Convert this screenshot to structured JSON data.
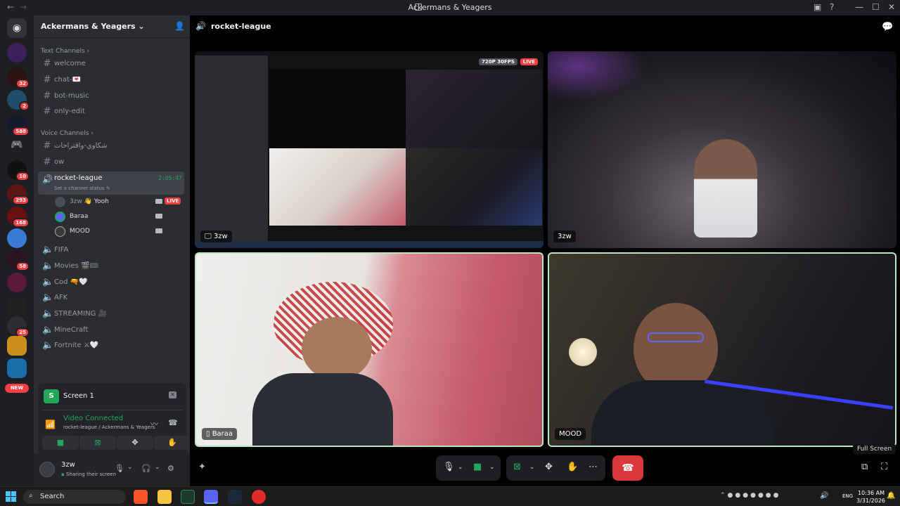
{
  "window": {
    "title": "Ackermans & Yeagers",
    "controls": [
      "minimize",
      "maximize",
      "close"
    ]
  },
  "servers": {
    "badges": [
      "32",
      "2",
      "588",
      "10",
      "293",
      "168",
      "58",
      "25"
    ],
    "new_label": "NEW"
  },
  "server": {
    "name": "Ackermans & Yeagers",
    "text_category": "Text Channels",
    "text_channels": [
      "welcome",
      "chat-💌",
      "bot-music",
      "only-edit"
    ],
    "voice_category": "Voice Channels",
    "voice_channels_top": [
      "شكاوي-واقتراحات",
      "ow"
    ],
    "active_channel": {
      "name": "rocket-league",
      "time": "2:05:47",
      "status_placeholder": "Set a channel status"
    },
    "voice_users": [
      {
        "name": "3zw",
        "suffix": "👋 Yooh",
        "live": "LIVE"
      },
      {
        "name": "Baraa"
      },
      {
        "name": "MOOD"
      }
    ],
    "voice_channels_bottom": [
      "FIFA",
      "Movies 🎬🎟",
      "Cod 🔫🤍",
      "AFK",
      "STREAMING 🎥",
      "MineCraft",
      "Fortnite ⚔🤍"
    ]
  },
  "panel": {
    "screen_title": "Screen 1",
    "connection_title": "Video Connected",
    "connection_sub": "rocket-league / Ackermans & Yeagers"
  },
  "user": {
    "name": "3zw",
    "status": "Sharing their screen"
  },
  "call": {
    "channel_name": "rocket-league",
    "stream_badge_quality": "720P 30FPS",
    "stream_badge_live": "LIVE",
    "tiles": [
      {
        "name": "3zw"
      },
      {
        "name": "3zw"
      },
      {
        "name": "Baraa"
      },
      {
        "name": "MOOD"
      }
    ],
    "tooltip": "Full Screen"
  },
  "taskbar": {
    "search_placeholder": "Search",
    "language": "ENG",
    "time": "10:36 AM",
    "date": "3/31/2026"
  },
  "colors": {
    "accent_green": "#23a55a",
    "danger_red": "#da373c",
    "sidebar_bg": "#2b2d31",
    "rail_bg": "#1e1f22"
  }
}
